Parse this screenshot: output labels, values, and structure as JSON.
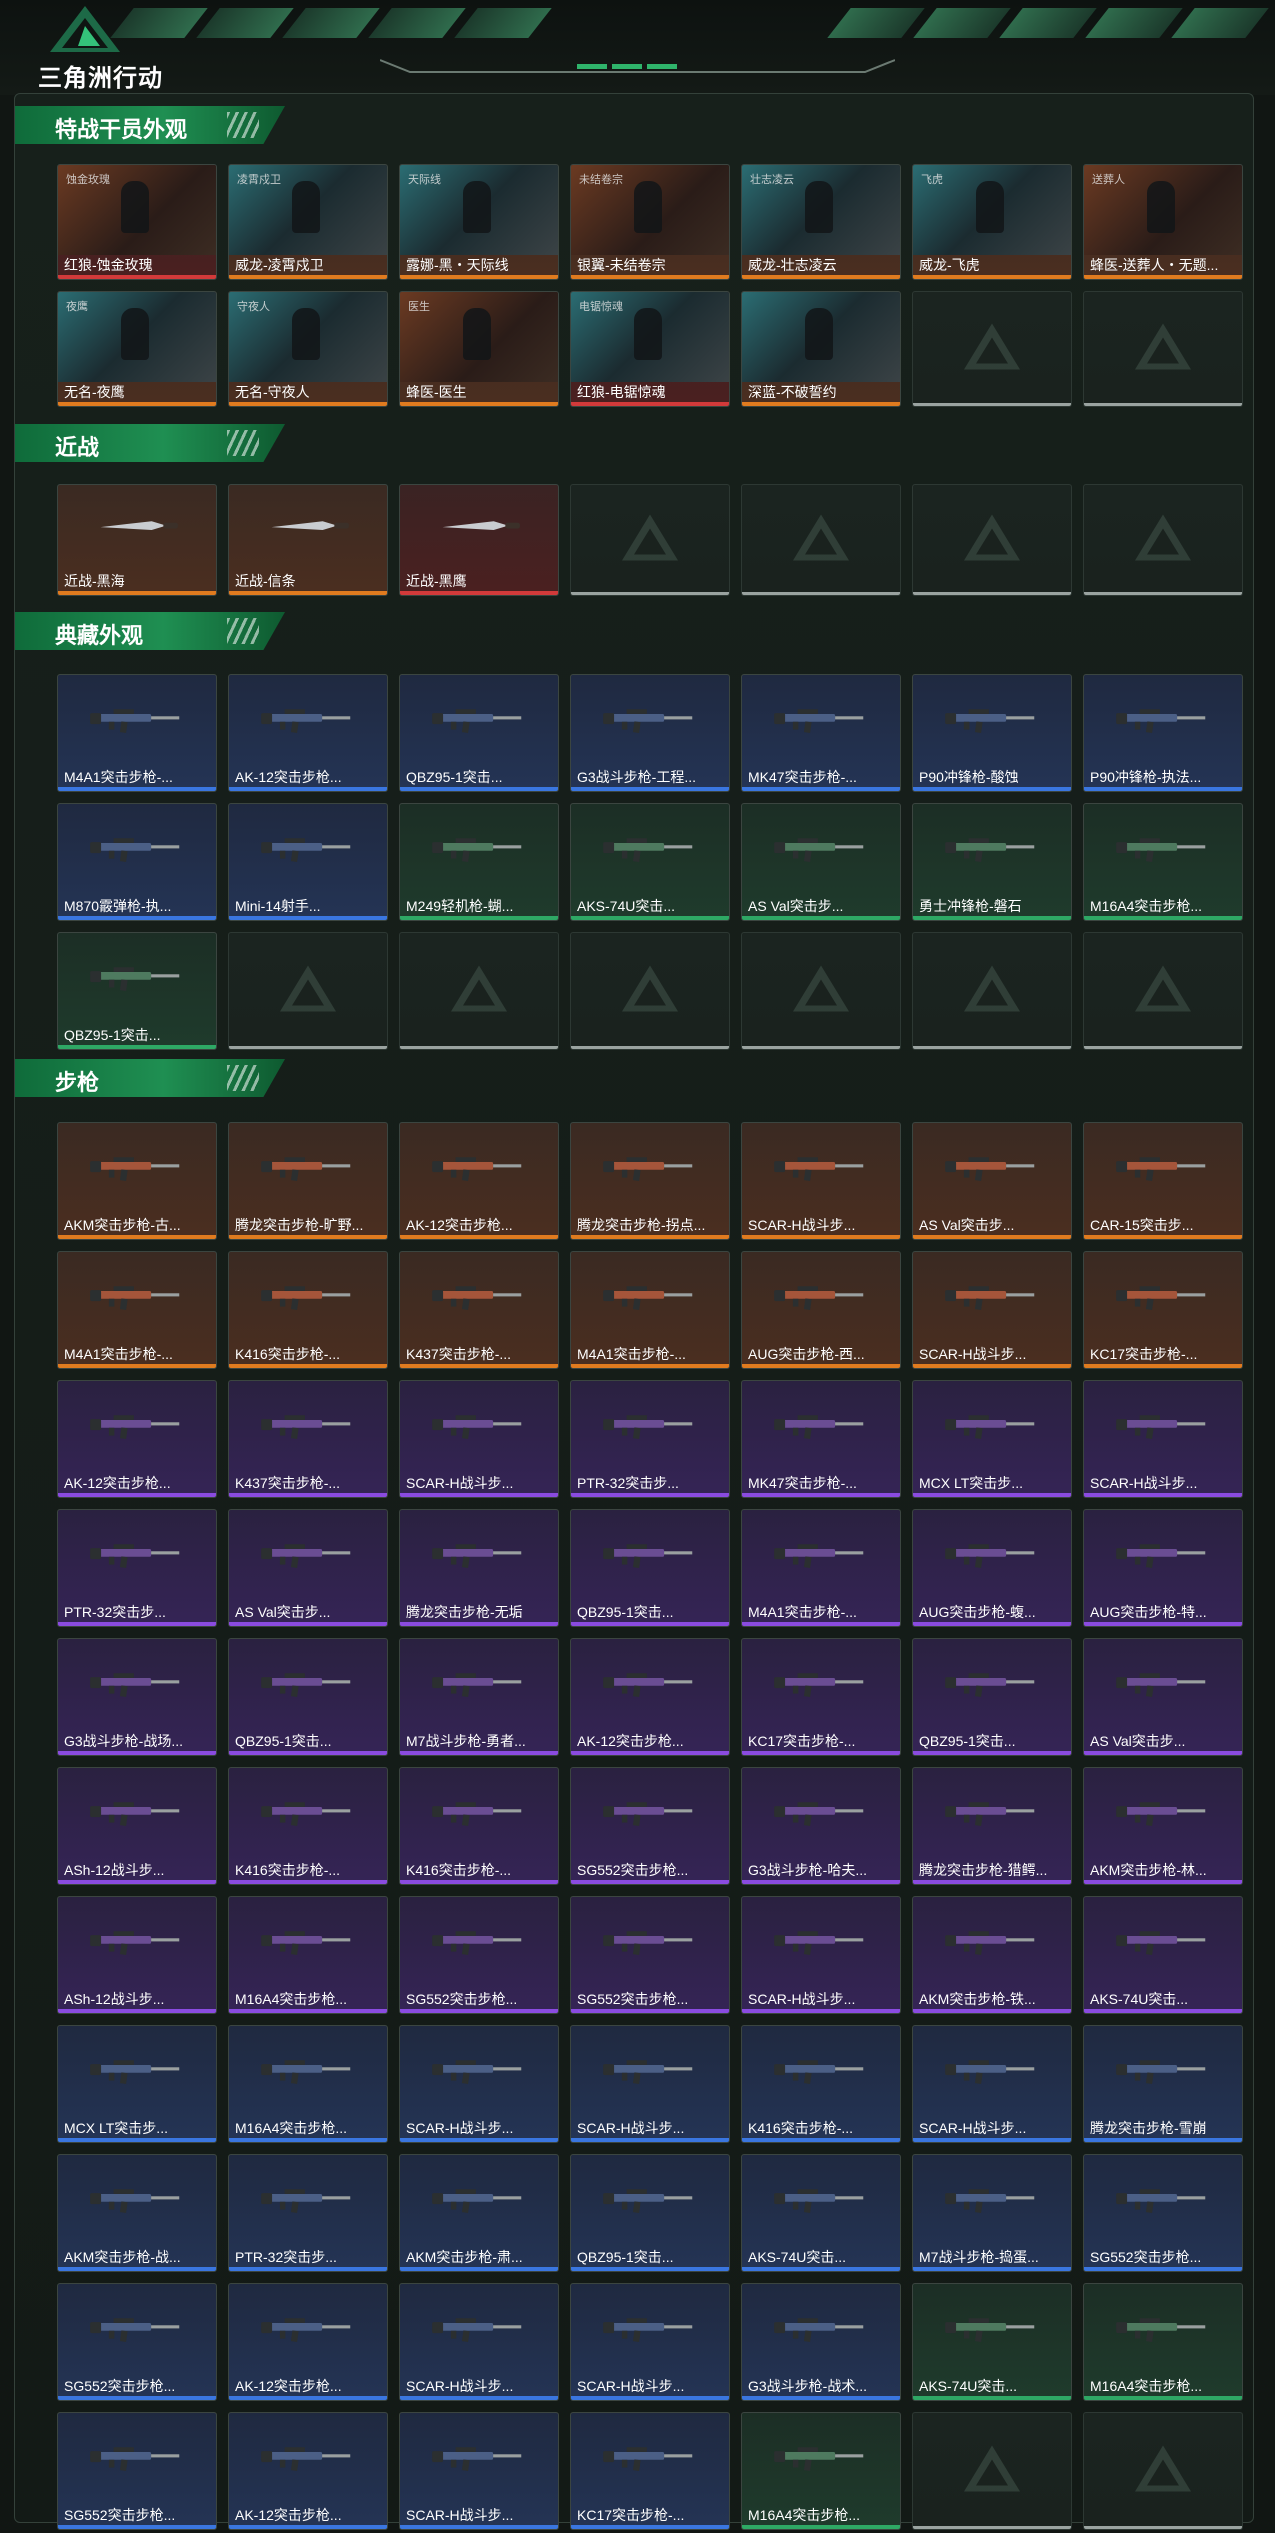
{
  "header": {
    "logo_text": "三角洲行动"
  },
  "sections": {
    "operators": {
      "title": "特战干员外观",
      "items": [
        {
          "label": "红狼-蚀金玫瑰",
          "tag": "蚀金玫瑰",
          "rarity": "red"
        },
        {
          "label": "威龙-凌霄戍卫",
          "tag": "凌霄戍卫",
          "rarity": "orange"
        },
        {
          "label": "露娜-黑・天际线",
          "tag": "天际线",
          "rarity": "orange"
        },
        {
          "label": "银翼-未结卷宗",
          "tag": "未结卷宗",
          "rarity": "orange"
        },
        {
          "label": "威龙-壮志凌云",
          "tag": "壮志凌云",
          "rarity": "orange"
        },
        {
          "label": "威龙-飞虎",
          "tag": "飞虎",
          "rarity": "orange"
        },
        {
          "label": "蜂医-送葬人・无题...",
          "tag": "送葬人",
          "rarity": "orange"
        },
        {
          "label": "无名-夜鹰",
          "tag": "夜鹰",
          "rarity": "orange"
        },
        {
          "label": "无名-守夜人",
          "tag": "守夜人",
          "rarity": "orange"
        },
        {
          "label": "蜂医-医生",
          "tag": "医生",
          "rarity": "orange"
        },
        {
          "label": "红狼-电锯惊魂",
          "tag": "电锯惊魂",
          "rarity": "red"
        },
        {
          "label": "深蓝-不破誓约",
          "tag": "",
          "rarity": "orange"
        }
      ]
    },
    "melee": {
      "title": "近战",
      "items": [
        {
          "label": "近战-黑海",
          "rarity": "orange"
        },
        {
          "label": "近战-信条",
          "rarity": "orange"
        },
        {
          "label": "近战-黑鹰",
          "rarity": "red"
        }
      ]
    },
    "collection": {
      "title": "典藏外观",
      "items": [
        {
          "label": "M4A1突击步枪-...",
          "rarity": "blue"
        },
        {
          "label": "AK-12突击步枪...",
          "rarity": "blue"
        },
        {
          "label": "QBZ95-1突击...",
          "rarity": "blue"
        },
        {
          "label": "G3战斗步枪-工程...",
          "rarity": "blue"
        },
        {
          "label": "MK47突击步枪-...",
          "rarity": "blue"
        },
        {
          "label": "P90冲锋枪-酸蚀",
          "rarity": "blue"
        },
        {
          "label": "P90冲锋枪-执法...",
          "rarity": "blue"
        },
        {
          "label": "M870霰弹枪-执...",
          "rarity": "blue"
        },
        {
          "label": "Mini-14射手...",
          "rarity": "blue"
        },
        {
          "label": "M249轻机枪-蝴...",
          "rarity": "green"
        },
        {
          "label": "AKS-74U突击...",
          "rarity": "green"
        },
        {
          "label": "AS Val突击步...",
          "rarity": "green"
        },
        {
          "label": "勇士冲锋枪-磐石",
          "rarity": "green"
        },
        {
          "label": "M16A4突击步枪...",
          "rarity": "green"
        },
        {
          "label": "QBZ95-1突击...",
          "rarity": "green"
        }
      ]
    },
    "rifles": {
      "title": "步枪",
      "items": [
        {
          "label": "AKM突击步枪-古...",
          "rarity": "orange"
        },
        {
          "label": "腾龙突击步枪-旷野...",
          "rarity": "orange"
        },
        {
          "label": "AK-12突击步枪...",
          "rarity": "orange"
        },
        {
          "label": "腾龙突击步枪-拐点...",
          "rarity": "orange"
        },
        {
          "label": "SCAR-H战斗步...",
          "rarity": "orange"
        },
        {
          "label": "AS Val突击步...",
          "rarity": "orange"
        },
        {
          "label": "CAR-15突击步...",
          "rarity": "orange"
        },
        {
          "label": "M4A1突击步枪-...",
          "rarity": "orange"
        },
        {
          "label": "K416突击步枪-...",
          "rarity": "orange"
        },
        {
          "label": "K437突击步枪-...",
          "rarity": "orange"
        },
        {
          "label": "M4A1突击步枪-...",
          "rarity": "orange"
        },
        {
          "label": "AUG突击步枪-西...",
          "rarity": "orange"
        },
        {
          "label": "SCAR-H战斗步...",
          "rarity": "orange"
        },
        {
          "label": "KC17突击步枪-...",
          "rarity": "orange"
        },
        {
          "label": "AK-12突击步枪...",
          "rarity": "purple"
        },
        {
          "label": "K437突击步枪-...",
          "rarity": "purple"
        },
        {
          "label": "SCAR-H战斗步...",
          "rarity": "purple"
        },
        {
          "label": "PTR-32突击步...",
          "rarity": "purple"
        },
        {
          "label": "MK47突击步枪-...",
          "rarity": "purple"
        },
        {
          "label": "MCX LT突击步...",
          "rarity": "purple"
        },
        {
          "label": "SCAR-H战斗步...",
          "rarity": "purple"
        },
        {
          "label": "PTR-32突击步...",
          "rarity": "purple"
        },
        {
          "label": "AS Val突击步...",
          "rarity": "purple"
        },
        {
          "label": "腾龙突击步枪-无垢",
          "rarity": "purple"
        },
        {
          "label": "QBZ95-1突击...",
          "rarity": "purple"
        },
        {
          "label": "M4A1突击步枪-...",
          "rarity": "purple"
        },
        {
          "label": "AUG突击步枪-蝮...",
          "rarity": "purple"
        },
        {
          "label": "AUG突击步枪-特...",
          "rarity": "purple"
        },
        {
          "label": "G3战斗步枪-战场...",
          "rarity": "purple"
        },
        {
          "label": "QBZ95-1突击...",
          "rarity": "purple"
        },
        {
          "label": "M7战斗步枪-勇者...",
          "rarity": "purple"
        },
        {
          "label": "AK-12突击步枪...",
          "rarity": "purple"
        },
        {
          "label": "KC17突击步枪-...",
          "rarity": "purple"
        },
        {
          "label": "QBZ95-1突击...",
          "rarity": "purple"
        },
        {
          "label": "AS Val突击步...",
          "rarity": "purple"
        },
        {
          "label": "ASh-12战斗步...",
          "rarity": "purple"
        },
        {
          "label": "K416突击步枪-...",
          "rarity": "purple"
        },
        {
          "label": "K416突击步枪-...",
          "rarity": "purple"
        },
        {
          "label": "SG552突击步枪...",
          "rarity": "purple"
        },
        {
          "label": "G3战斗步枪-哈夫...",
          "rarity": "purple"
        },
        {
          "label": "腾龙突击步枪-猎鳄...",
          "rarity": "purple"
        },
        {
          "label": "AKM突击步枪-林...",
          "rarity": "purple"
        },
        {
          "label": "ASh-12战斗步...",
          "rarity": "purple"
        },
        {
          "label": "M16A4突击步枪...",
          "rarity": "purple"
        },
        {
          "label": "SG552突击步枪...",
          "rarity": "purple"
        },
        {
          "label": "SG552突击步枪...",
          "rarity": "purple"
        },
        {
          "label": "SCAR-H战斗步...",
          "rarity": "purple"
        },
        {
          "label": "AKM突击步枪-铁...",
          "rarity": "purple"
        },
        {
          "label": "AKS-74U突击...",
          "rarity": "purple"
        },
        {
          "label": "MCX LT突击步...",
          "rarity": "blue"
        },
        {
          "label": "M16A4突击步枪...",
          "rarity": "blue"
        },
        {
          "label": "SCAR-H战斗步...",
          "rarity": "blue"
        },
        {
          "label": "SCAR-H战斗步...",
          "rarity": "blue"
        },
        {
          "label": "K416突击步枪-...",
          "rarity": "blue"
        },
        {
          "label": "SCAR-H战斗步...",
          "rarity": "blue"
        },
        {
          "label": "腾龙突击步枪-雪崩",
          "rarity": "blue"
        },
        {
          "label": "AKM突击步枪-战...",
          "rarity": "blue"
        },
        {
          "label": "PTR-32突击步...",
          "rarity": "blue"
        },
        {
          "label": "AKM突击步枪-肃...",
          "rarity": "blue"
        },
        {
          "label": "QBZ95-1突击...",
          "rarity": "blue"
        },
        {
          "label": "AKS-74U突击...",
          "rarity": "blue"
        },
        {
          "label": "M7战斗步枪-捣蛋...",
          "rarity": "blue"
        },
        {
          "label": "SG552突击步枪...",
          "rarity": "blue"
        },
        {
          "label": "SG552突击步枪...",
          "rarity": "blue"
        },
        {
          "label": "AK-12突击步枪...",
          "rarity": "blue"
        },
        {
          "label": "SCAR-H战斗步...",
          "rarity": "blue"
        },
        {
          "label": "SCAR-H战斗步...",
          "rarity": "blue"
        },
        {
          "label": "G3战斗步枪-战术...",
          "rarity": "blue"
        },
        {
          "label": "AKS-74U突击...",
          "rarity": "green"
        },
        {
          "label": "M16A4突击步枪...",
          "rarity": "green"
        },
        {
          "label": "SG552突击步枪...",
          "rarity": "blue"
        },
        {
          "label": "AK-12突击步枪...",
          "rarity": "blue"
        },
        {
          "label": "SCAR-H战斗步...",
          "rarity": "blue"
        },
        {
          "label": "KC17突击步枪-...",
          "rarity": "blue"
        },
        {
          "label": "M16A4突击步枪...",
          "rarity": "green"
        }
      ]
    }
  },
  "colors": {
    "accent": "#1f8f52",
    "rarity_orange": "#e07b1f",
    "rarity_red": "#d23a3a",
    "rarity_blue": "#3a76e0",
    "rarity_green": "#2ea865",
    "rarity_purple": "#8a4be0",
    "empty_slot": "#9aa3a0"
  }
}
